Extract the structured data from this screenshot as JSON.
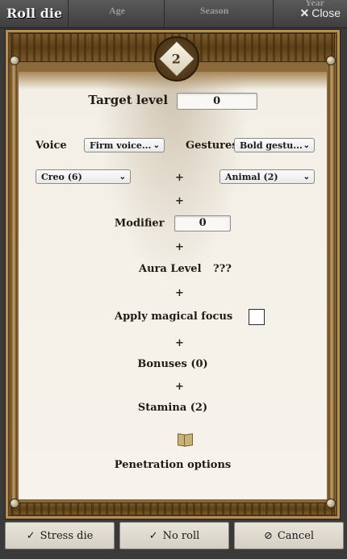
{
  "window": {
    "title": "Roll die",
    "close_label": "Close",
    "background_columns": [
      "Age",
      "Season",
      "Year"
    ]
  },
  "die": {
    "face": "2"
  },
  "target": {
    "label": "Target level",
    "value": "0"
  },
  "voice": {
    "label": "Voice",
    "selected": "Firm voice..."
  },
  "gestures": {
    "label": "Gestures",
    "selected": "Bold gestu..."
  },
  "technique": {
    "selected": "Creo (6)"
  },
  "form": {
    "selected": "Animal (2)"
  },
  "plus": "+",
  "modifier": {
    "label": "Modifier",
    "value": "0"
  },
  "aura": {
    "label": "Aura Level",
    "value": "???"
  },
  "focus": {
    "label": "Apply magical focus"
  },
  "bonuses": {
    "label": "Bonuses (0)"
  },
  "stamina": {
    "label": "Stamina (2)"
  },
  "penetration": {
    "label": "Penetration options"
  },
  "buttons": {
    "stress": "Stress die",
    "noroll": "No roll",
    "cancel": "Cancel"
  }
}
